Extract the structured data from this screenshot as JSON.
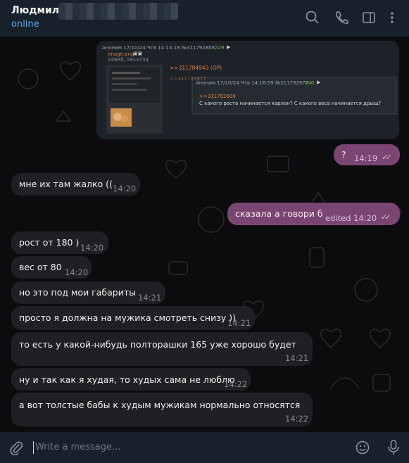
{
  "header": {
    "name": "Людмила",
    "status": "online",
    "icons": [
      "search-icon",
      "phone-icon",
      "sidebar-toggle-icon",
      "more-vertical-icon"
    ]
  },
  "image_post": {
    "header": "Аноним 17/10/24 Чтв 14:13:18 №311792808",
    "header_count": "229",
    "file_name": "image.png",
    "file_meta": "246Кб, 591x734",
    "reply_link": ">>311784943 (OP)",
    "backref": ">>311792977",
    "reply_header": "Аноним 17/10/24 Чтв 14:16:59 №311792977",
    "reply_count": "240",
    "reply_quote": ">>311792808",
    "reply_text": "С какого роста начинается карлан? С какого веса начинается дрыщ?"
  },
  "messages": [
    {
      "dir": "out",
      "text": "?",
      "time": "14:19",
      "checks": "✓✓"
    },
    {
      "dir": "in",
      "text": "мне их там жалко ((",
      "time": "14:20"
    },
    {
      "dir": "out",
      "text": "сказала а говори б",
      "time": "edited 14:20",
      "checks": "✓✓"
    },
    {
      "dir": "in",
      "text": "рост от 180 )",
      "time": "14:20"
    },
    {
      "dir": "in",
      "text": "вес от 80",
      "time": "14:20"
    },
    {
      "dir": "in",
      "text": "но это под мои габариты",
      "time": "14:21"
    },
    {
      "dir": "in",
      "text": "просто я должна на мужика смотреть снизу ))",
      "time": "14:21"
    },
    {
      "dir": "in",
      "text": "то есть у какой-нибудь полторашки 165 уже хорошо будет",
      "time": "14:21"
    },
    {
      "dir": "in",
      "text": "ну и так как я худая, то худых сама не люблю",
      "time": "14:22"
    },
    {
      "dir": "in",
      "text": "а вот толстые бабы к худым мужикам нормально относятся",
      "time": "14:22"
    }
  ],
  "input": {
    "placeholder": "Write a message...",
    "icons": [
      "paperclip-icon",
      "emoji-icon",
      "microphone-icon"
    ]
  },
  "colors": {
    "header_bg": "#17212b",
    "incoming_bubble": "#1f2024",
    "outgoing_bubble": "#7a4671",
    "status": "#5ba9e6",
    "post_link": "#e0813a"
  }
}
